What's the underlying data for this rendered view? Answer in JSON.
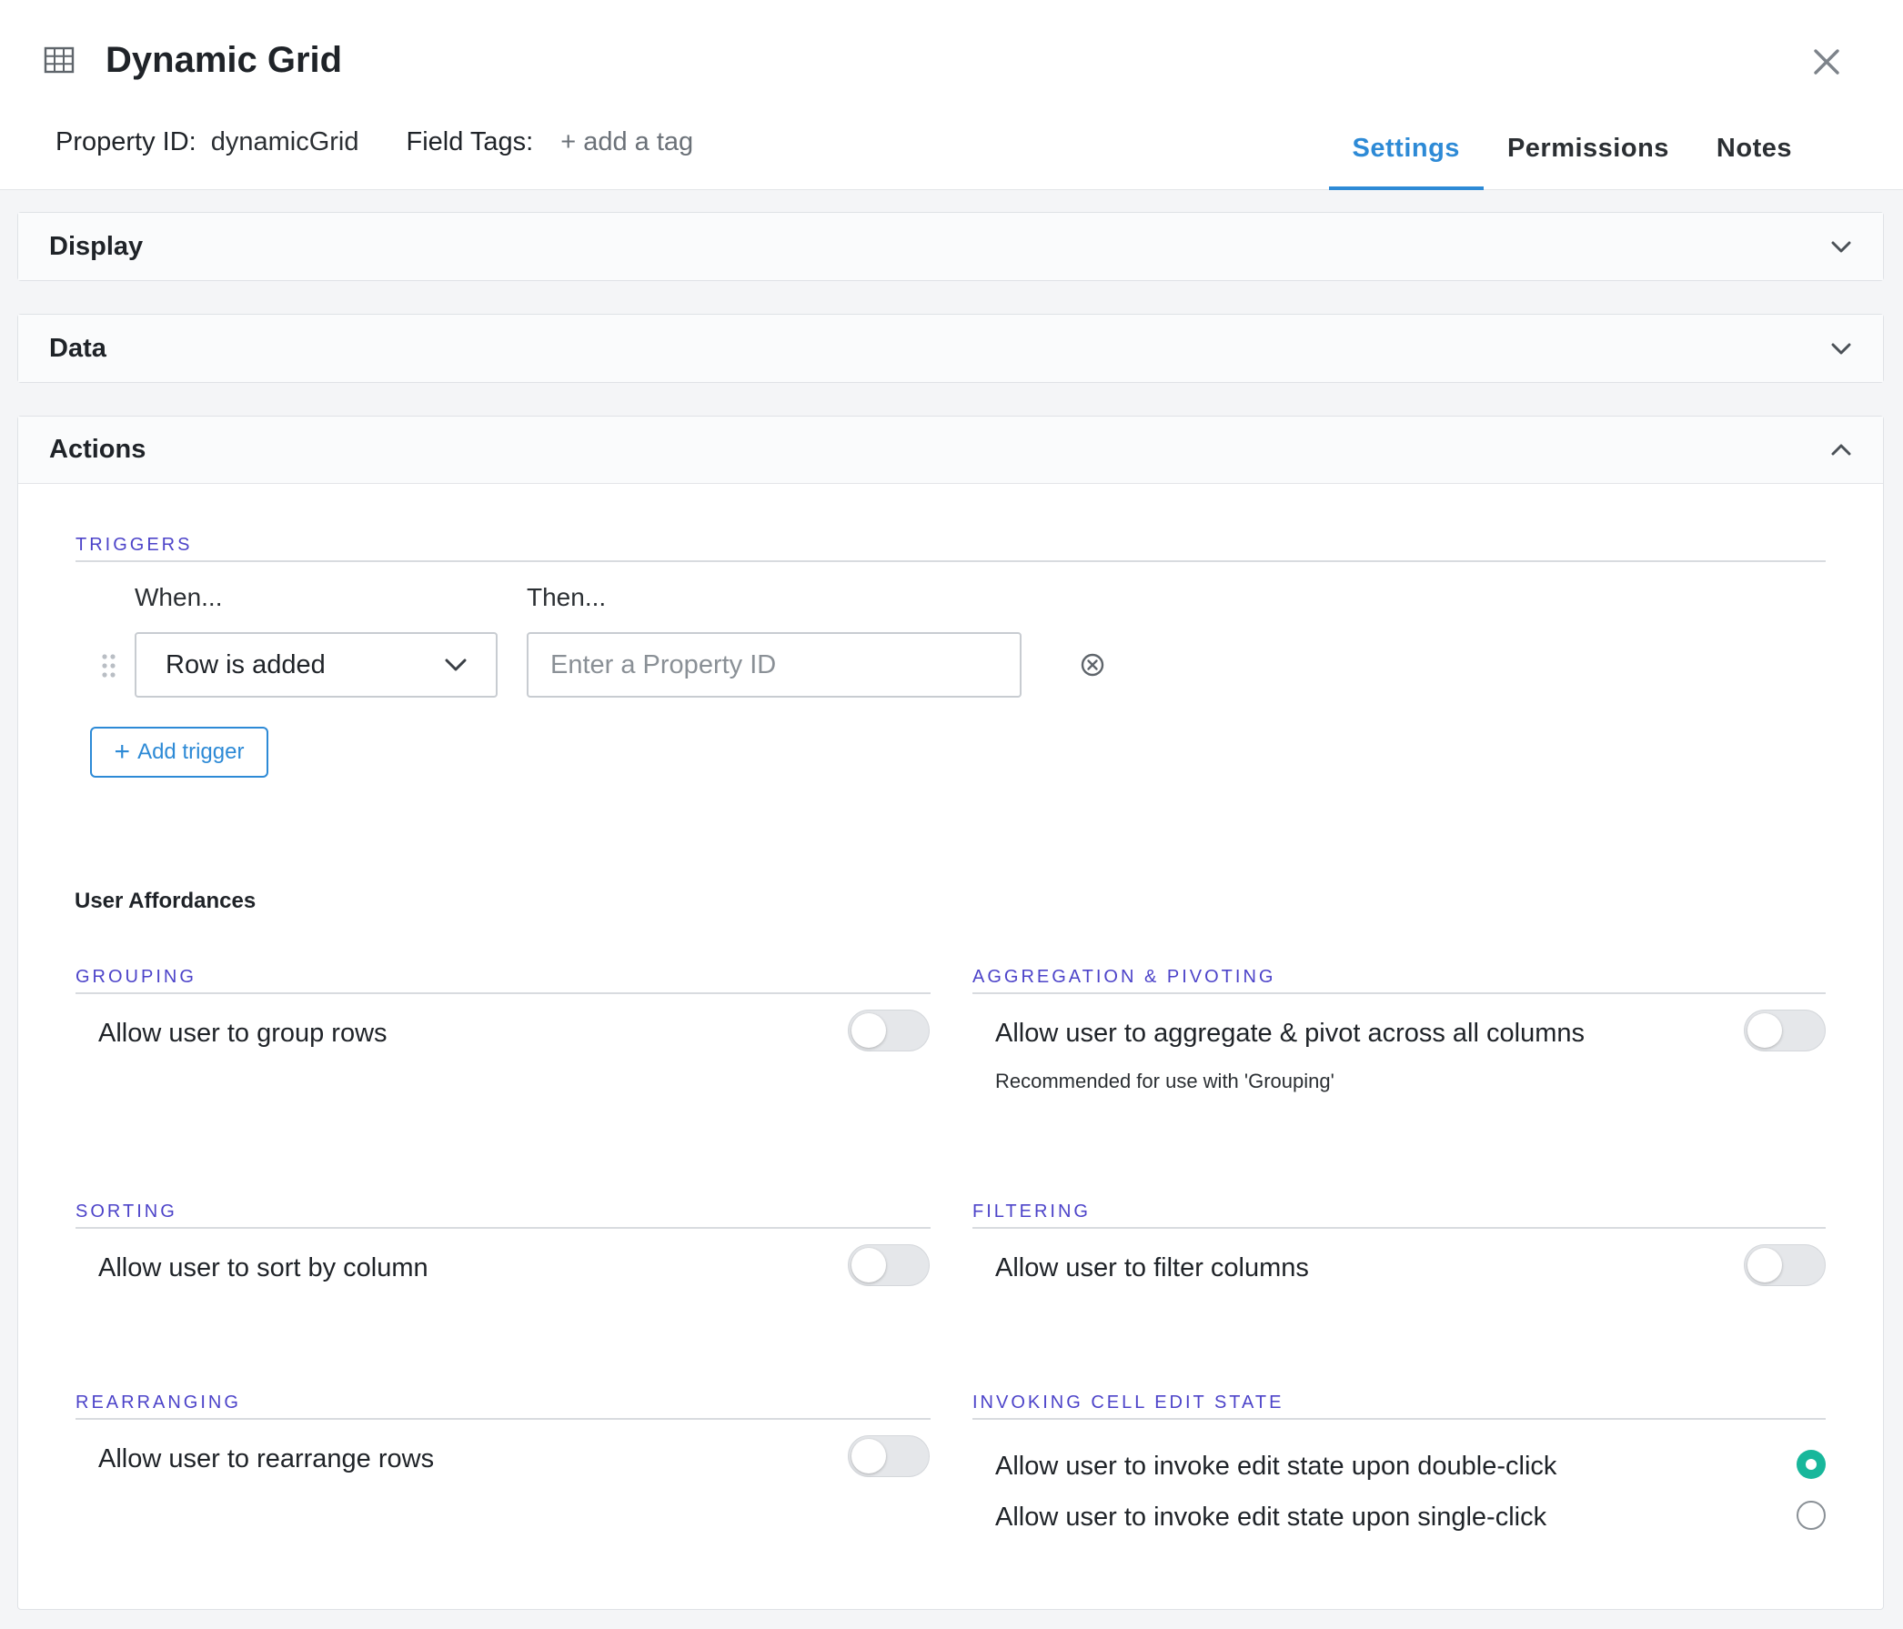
{
  "header": {
    "title": "Dynamic Grid",
    "title_icon": "grid-icon",
    "close_icon": "close-icon",
    "property_id_label": "Property ID:",
    "property_id_value": "dynamicGrid",
    "field_tags_label": "Field Tags:",
    "add_tag_label": "+ add a tag",
    "tabs": [
      {
        "label": "Settings",
        "active": true
      },
      {
        "label": "Permissions",
        "active": false
      },
      {
        "label": "Notes",
        "active": false
      }
    ]
  },
  "sections": {
    "display": {
      "title": "Display",
      "expanded": false
    },
    "data": {
      "title": "Data",
      "expanded": false
    },
    "actions": {
      "title": "Actions",
      "expanded": true
    }
  },
  "triggers": {
    "label": "TRIGGERS",
    "when_label": "When...",
    "then_label": "Then...",
    "rows": [
      {
        "when_value": "Row is added",
        "then_placeholder": "Enter a Property ID",
        "then_value": ""
      }
    ],
    "add_label": "Add trigger"
  },
  "affordances": {
    "title": "User Affordances",
    "grouping": {
      "label": "GROUPING",
      "option": "Allow user to group rows",
      "enabled": false
    },
    "aggregation": {
      "label": "AGGREGATION & PIVOTING",
      "option": "Allow user to aggregate & pivot across all columns",
      "note": "Recommended for use with 'Grouping'",
      "enabled": false
    },
    "sorting": {
      "label": "SORTING",
      "option": "Allow user to sort by column",
      "enabled": false
    },
    "filtering": {
      "label": "FILTERING",
      "option": "Allow user to filter columns",
      "enabled": false
    },
    "rearranging": {
      "label": "REARRANGING",
      "option": "Allow user to rearrange rows",
      "enabled": false
    },
    "cell_edit": {
      "label": "INVOKING CELL EDIT STATE",
      "options": [
        {
          "label": "Allow user to invoke edit state upon double-click",
          "selected": true
        },
        {
          "label": "Allow user to invoke edit state upon single-click",
          "selected": false
        }
      ]
    }
  },
  "colors": {
    "accent": "#2d8ad6",
    "section_label": "#4c43c9",
    "radio_selected": "#18b79b"
  }
}
